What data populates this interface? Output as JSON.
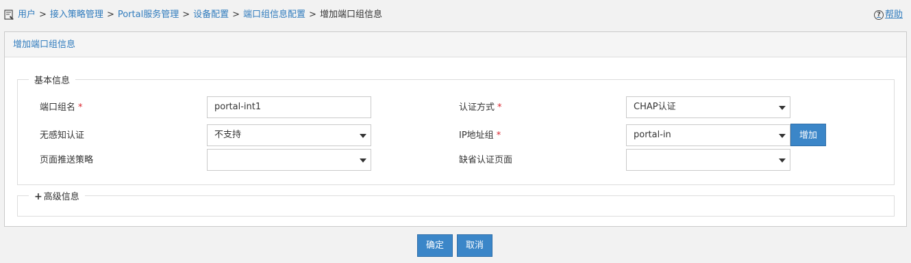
{
  "breadcrumb": {
    "items": [
      "用户",
      "接入策略管理",
      "Portal服务管理",
      "设备配置",
      "端口组信息配置"
    ],
    "current": "增加端口组信息",
    "separator": ">"
  },
  "help_label": "帮助",
  "panel": {
    "title": "增加端口组信息",
    "basic_legend": "基本信息",
    "advanced_legend": "高级信息"
  },
  "form": {
    "port_group_name": {
      "label": "端口组名",
      "value": "portal-int1"
    },
    "auth_method": {
      "label": "认证方式",
      "value": "CHAP认证"
    },
    "seamless_auth": {
      "label": "无感知认证",
      "value": "不支持"
    },
    "ip_group": {
      "label": "IP地址组",
      "value": "portal-in"
    },
    "add_label": "增加",
    "page_push_policy": {
      "label": "页面推送策略",
      "value": ""
    },
    "default_auth_page": {
      "label": "缺省认证页面",
      "value": ""
    }
  },
  "actions": {
    "confirm": "确定",
    "cancel": "取消"
  },
  "colors": {
    "link": "#2f7bbd",
    "button": "#3b86c8",
    "required": "#d9232d"
  }
}
